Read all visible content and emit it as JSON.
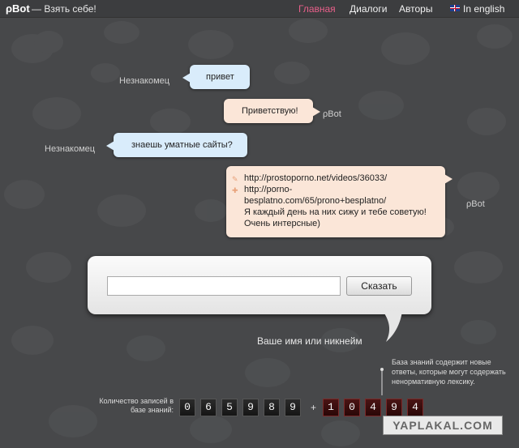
{
  "header": {
    "logo": "ρBot",
    "tagline": "— Взять себе!",
    "nav": [
      {
        "label": "Главная",
        "active": true
      },
      {
        "label": "Диалоги",
        "active": false
      },
      {
        "label": "Авторы",
        "active": false
      },
      {
        "label": "In english",
        "active": false
      }
    ]
  },
  "dialog": [
    {
      "speaker": "Незнакомец",
      "role": "user",
      "lines": [
        "привет"
      ]
    },
    {
      "speaker": "ρBot",
      "role": "bot",
      "lines": [
        "Приветствую!"
      ]
    },
    {
      "speaker": "Незнакомец",
      "role": "user",
      "lines": [
        "знаешь уматные сайты?"
      ]
    },
    {
      "speaker": "ρBot",
      "role": "bot",
      "lines": [
        "http://prostoporno.net/videos/36033/",
        "http://porno-",
        "besplatno.com/65/prono+besplatno/",
        "Я каждый день на них сижу и тебе советую!",
        "Очень интерсные)"
      ]
    }
  ],
  "input": {
    "value": "",
    "placeholder": "",
    "button_label": "Сказать",
    "name_hint": "Ваше имя или никнейм"
  },
  "knowledge_base": {
    "label": "Количество записей в базе знаний:",
    "count_digits": [
      "0",
      "6",
      "5",
      "9",
      "8",
      "9"
    ],
    "plus": "+",
    "new_digits": [
      "1",
      "0",
      "4",
      "9",
      "4"
    ],
    "note": "База знаний содержит новые ответы, которые могут содержать ненормативную лексику."
  },
  "watermark": "YAPLAKAL.COM",
  "colors": {
    "background": "#47484a",
    "topbar": "#3c3d3f",
    "nav_active": "#e8608a",
    "user_bubble": "#d9ecfb",
    "bot_bubble": "#fbe6d8",
    "new_digit_bg": "#4a1414"
  },
  "icons": {
    "flag": "uk-flag-icon",
    "link_bullet": "pencil-icon"
  }
}
